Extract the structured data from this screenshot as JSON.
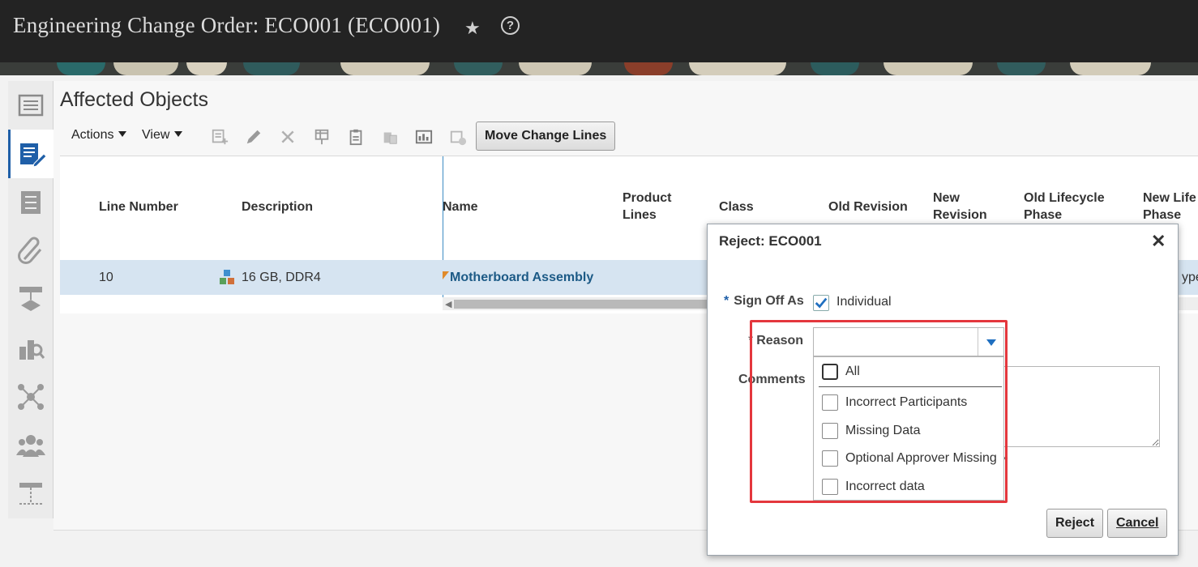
{
  "header": {
    "title": "Engineering Change Order: ECO001 (ECO001)",
    "star_icon": "★",
    "help_icon": "?"
  },
  "rail": {
    "items": [
      "overview-icon",
      "lines-icon",
      "checklist-icon",
      "attachment-icon",
      "flow-icon",
      "search-docs-icon",
      "network-icon",
      "people-icon",
      "structure-icon"
    ]
  },
  "page": {
    "title": "Affected Objects"
  },
  "toolbar": {
    "actions_label": "Actions",
    "view_label": "View",
    "move_change_lines_label": "Move Change Lines"
  },
  "table": {
    "columns": [
      "Line Number",
      "Description",
      "Name",
      "Product Lines",
      "Class",
      "Old Revision",
      "New Revision",
      "Old Lifecycle Phase",
      "New Lifecycle Phase"
    ],
    "column_lines": {
      "product_lines": [
        "Product",
        "Lines"
      ],
      "new_revision": [
        "New",
        "Revision"
      ],
      "old_lifecycle": [
        "Old Lifecycle",
        "Phase"
      ],
      "new_lifecycle": [
        "New Life",
        "Phase"
      ]
    },
    "rows": [
      {
        "line_number": "10",
        "description": "16 GB, DDR4",
        "name": "Motherboard Assembly",
        "trailing": "ype"
      }
    ]
  },
  "dialog": {
    "title": "Reject: ECO001",
    "close_icon": "✕",
    "sign_off_as_label": "Sign Off As",
    "sign_off_option": "Individual",
    "sign_off_checked": true,
    "reason_label": "Reason",
    "reason_value": "",
    "comments_label": "Comments",
    "required_mark": "*",
    "reason_options": [
      {
        "label": "All",
        "checked": false
      },
      {
        "label": "Incorrect Participants",
        "checked": false
      },
      {
        "label": "Missing Data",
        "checked": false
      },
      {
        "label": "Optional Approver Missing",
        "checked": false
      },
      {
        "label": "Incorrect data",
        "checked": false
      }
    ],
    "reject_label": "Reject",
    "cancel_label": "Cancel"
  },
  "colors": {
    "header_bg": "#232323",
    "accent_blue": "#1f5fa8",
    "selected_row": "#d6e4f1",
    "highlight_red": "#e4373d",
    "link": "#1c5a86"
  }
}
